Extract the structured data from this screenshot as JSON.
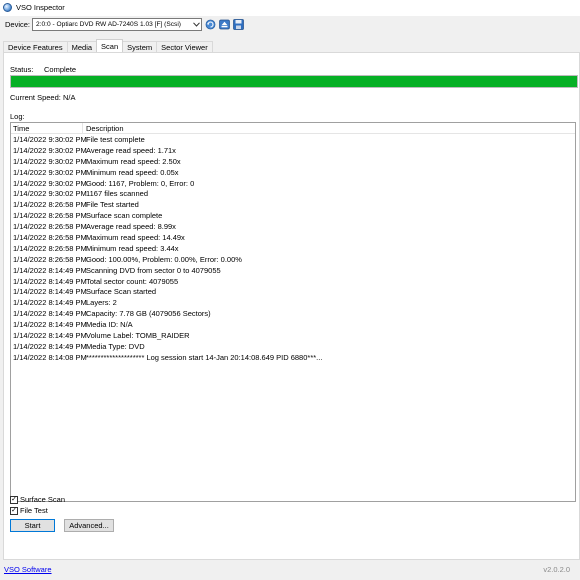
{
  "window": {
    "title": "VSO Inspector"
  },
  "device": {
    "label": "Device:",
    "selected": "2:0:0 - Optiarc DVD RW AD-7240S 1.03 [F] (Scsi)"
  },
  "icons": {
    "app": "disc-app-icon",
    "refresh": "refresh-icon",
    "eject": "eject-icon",
    "save": "save-icon",
    "dropdown": "chevron-down-icon"
  },
  "tabs": [
    {
      "label": "Device Features"
    },
    {
      "label": "Media"
    },
    {
      "label": "Scan",
      "active": true
    },
    {
      "label": "System"
    },
    {
      "label": "Sector Viewer"
    }
  ],
  "scan": {
    "status_label": "Status:",
    "status_value": "Complete",
    "progress": 1.0,
    "current_speed": "Current Speed: N/A",
    "log_label": "Log:"
  },
  "log": {
    "columns": {
      "time": "Time",
      "description": "Description"
    },
    "rows": [
      {
        "time": "1/14/2022 9:30:02 PM",
        "desc": "File test complete"
      },
      {
        "time": "1/14/2022 9:30:02 PM",
        "desc": "Average read speed: 1.71x"
      },
      {
        "time": "1/14/2022 9:30:02 PM",
        "desc": "Maximum read speed: 2.50x"
      },
      {
        "time": "1/14/2022 9:30:02 PM",
        "desc": "Minimum read speed: 0.05x"
      },
      {
        "time": "1/14/2022 9:30:02 PM",
        "desc": "Good: 1167, Problem: 0, Error: 0"
      },
      {
        "time": "1/14/2022 9:30:02 PM",
        "desc": "1167 files scanned"
      },
      {
        "time": "1/14/2022 8:26:58 PM",
        "desc": "File Test started"
      },
      {
        "time": "1/14/2022 8:26:58 PM",
        "desc": "Surface scan complete"
      },
      {
        "time": "1/14/2022 8:26:58 PM",
        "desc": "Average read speed: 8.99x"
      },
      {
        "time": "1/14/2022 8:26:58 PM",
        "desc": "Maximum read speed: 14.49x"
      },
      {
        "time": "1/14/2022 8:26:58 PM",
        "desc": "Minimum read speed: 3.44x"
      },
      {
        "time": "1/14/2022 8:26:58 PM",
        "desc": "Good: 100.00%, Problem: 0.00%, Error: 0.00%"
      },
      {
        "time": "1/14/2022 8:14:49 PM",
        "desc": "Scanning DVD from sector 0 to 4079055"
      },
      {
        "time": "1/14/2022 8:14:49 PM",
        "desc": "Total sector count: 4079055"
      },
      {
        "time": "1/14/2022 8:14:49 PM",
        "desc": "Surface Scan started"
      },
      {
        "time": "1/14/2022 8:14:49 PM",
        "desc": "Layers: 2"
      },
      {
        "time": "1/14/2022 8:14:49 PM",
        "desc": "Capacity: 7.78 GB (4079056 Sectors)"
      },
      {
        "time": "1/14/2022 8:14:49 PM",
        "desc": "Media ID: N/A"
      },
      {
        "time": "1/14/2022 8:14:49 PM",
        "desc": "Volume Label: TOMB_RAIDER"
      },
      {
        "time": "1/14/2022 8:14:49 PM",
        "desc": "Media Type: DVD"
      },
      {
        "time": "1/14/2022 8:14:08 PM",
        "desc": "******************** Log session start 14-Jan 20:14:08.649 PID 6880***..."
      }
    ]
  },
  "options": {
    "surface_scan": {
      "label": "Surface Scan",
      "checked": true
    },
    "file_test": {
      "label": "File Test",
      "checked": true
    }
  },
  "buttons": {
    "start": "Start",
    "advanced": "Advanced..."
  },
  "footer": {
    "link": "VSO Software",
    "version": "v2.0.2.0"
  },
  "colors": {
    "progress_fill": "#06b025",
    "link": "#0000ee",
    "accent": "#0078d7"
  }
}
